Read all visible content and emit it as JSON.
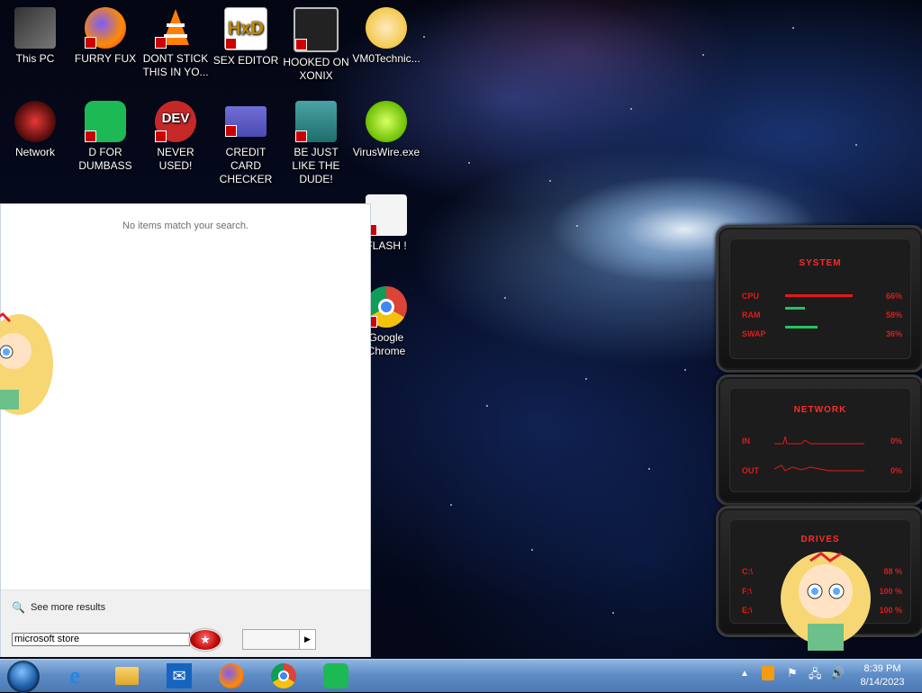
{
  "desktop": {
    "icons": [
      {
        "label": "This PC",
        "icon": "this-pc-icon"
      },
      {
        "label": "FURRY FUX",
        "icon": "firefox-icon"
      },
      {
        "label": "DONT STICK THIS IN YO...",
        "icon": "vlc-cone-icon"
      },
      {
        "label": "SEX EDITOR",
        "icon": "hxd-icon"
      },
      {
        "label": "HOOKED ON XONIX",
        "icon": "xonix-icon"
      },
      {
        "label": "VM0Technic...",
        "icon": "cartoon-girl-icon"
      },
      {
        "label": "Network",
        "icon": "network-icon"
      },
      {
        "label": "D FOR DUMBASS",
        "icon": "spotify-icon"
      },
      {
        "label": "NEVER USED!",
        "icon": "devcpp-icon"
      },
      {
        "label": "CREDIT CARD CHECKER",
        "icon": "credit-card-icon"
      },
      {
        "label": "BE JUST LIKE THE DUDE!",
        "icon": "santa-icon"
      },
      {
        "label": "VirusWire.exe",
        "icon": "limewire-icon"
      },
      {
        "label": "FLASH !",
        "icon": "flash-icon"
      },
      {
        "label": "Google Chrome",
        "icon": "chrome-icon"
      }
    ]
  },
  "start_menu": {
    "no_results": "No items match your search.",
    "see_more": "See more results",
    "search_value": "microsoft store"
  },
  "gadget": {
    "system": {
      "title": "SYSTEM",
      "rows": [
        {
          "label": "CPU",
          "value": "66%",
          "fraction": 0.66
        },
        {
          "label": "RAM",
          "value": "58%",
          "fraction": 0.58
        },
        {
          "label": "SWAP",
          "value": "36%",
          "fraction": 0.36
        }
      ]
    },
    "network": {
      "title": "NETWORK",
      "rows": [
        {
          "label": "IN",
          "value": "0%"
        },
        {
          "label": "OUT",
          "value": "0%"
        }
      ]
    },
    "drives": {
      "title": "DRIVES",
      "rows": [
        {
          "label": "C:\\",
          "value": "88 %"
        },
        {
          "label": "F:\\",
          "value": "100 %"
        },
        {
          "label": "E:\\",
          "value": "100 %"
        }
      ]
    }
  },
  "taskbar": {
    "pinned": [
      "internet-explorer-icon",
      "file-explorer-icon",
      "mail-icon",
      "firefox-icon",
      "chrome-icon",
      "spotify-icon"
    ],
    "time": "8:39 PM",
    "date": "8/14/2023"
  },
  "colors": {
    "gadget_accent": "#e01a1a",
    "taskbar": "#5f8dc6",
    "bar_green": "#22c55e"
  }
}
